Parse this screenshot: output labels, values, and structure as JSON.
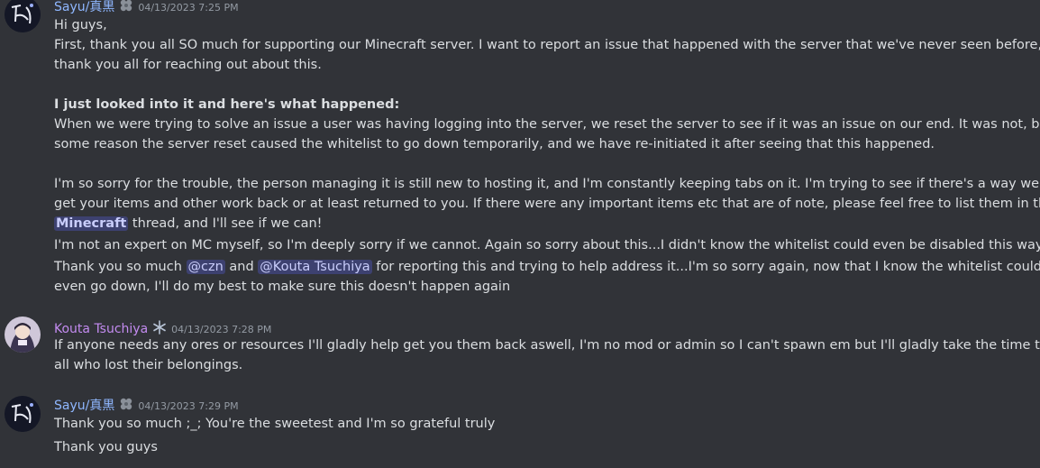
{
  "messages": [
    {
      "user": "Sayu/真黒",
      "user_color": "#8fb7ff",
      "timestamp": "04/13/2023 7:25 PM",
      "lines": {
        "l1": "Hi guys,",
        "l2": "First, thank you all SO much for supporting our Minecraft server. I want to report an issue that happened with the server that we've never seen before, and",
        "l3": "thank you all for reaching out about this.",
        "l4": "I just looked into it and here's what happened:",
        "l5": "When we were trying to solve an issue a user was having logging into the server, we reset the server to see if it was an issue on our end. It was not, but for",
        "l6": "some reason the server reset caused the whitelist to go down temporarily, and we have re-initiated it after seeing that this happened.",
        "l7": "I'm so sorry for the trouble, the person managing it is still new to hosting it, and I'm constantly keeping tabs on it. I'm trying to see if there's a way we can",
        "l8": "get your items and other work back or at least returned to you. If there were any important items etc that are of note, please feel free to list them in the",
        "channel_icon": "#",
        "channel_name": "Minecraft",
        "l9_tail": " thread, and I'll see if we can!",
        "l10": "I'm not an expert on MC myself, so I'm deeply sorry if we cannot. Again so sorry about this...I didn't know the whitelist could even be disabled this way.",
        "l11_a": "Thank you so much ",
        "mention1": "@czn",
        "l11_b": " and ",
        "mention2": "@Kouta Tsuchiya",
        "l11_c": " for reporting this and trying to help address it...I'm so sorry again, now that I know the whitelist could",
        "l12": "even go down, I'll do my best to make sure this doesn't happen again"
      }
    },
    {
      "user": "Kouta Tsuchiya",
      "user_color": "#c38bf0",
      "timestamp": "04/13/2023 7:28 PM",
      "lines": {
        "l1": "If anyone needs any ores or resources I'll gladly help get you them back aswell, I'm no mod or admin so I can't spawn em but I'll gladly take the time to help",
        "l2": "all who lost their belongings."
      }
    },
    {
      "user": "Sayu/真黒",
      "user_color": "#8fb7ff",
      "timestamp": "04/13/2023 7:29 PM",
      "lines": {
        "l1": "Thank you so much ;_; You're the sweetest and I'm so grateful truly",
        "l2": "Thank you guys"
      }
    }
  ],
  "icons": {
    "sayu_badge": "clover-badge-icon",
    "kouta_badge": "snowflake-badge-icon",
    "emoji": "frowning-face-emoji-icon"
  },
  "colors": {
    "background": "#313338",
    "mention_bg": "#3c4270",
    "mention_text": "#c9cdfb"
  }
}
